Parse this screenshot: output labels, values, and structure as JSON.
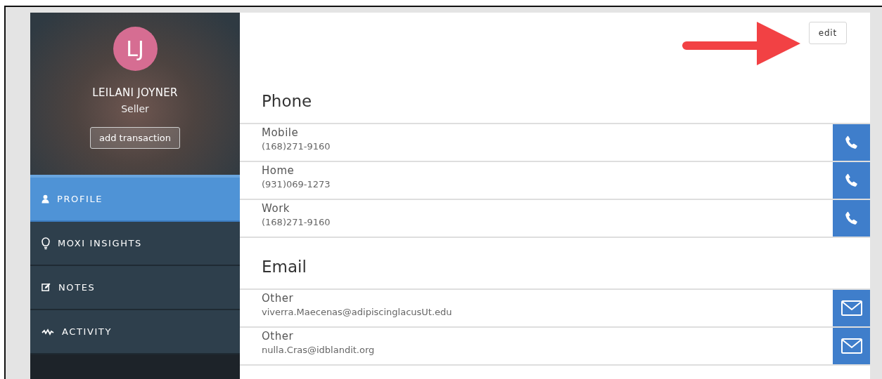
{
  "profile": {
    "initials": "LJ",
    "name": "LEILANI JOYNER",
    "role": "Seller",
    "action": "add transaction"
  },
  "nav": [
    {
      "label": "PROFILE",
      "kind": "user",
      "selected": true
    },
    {
      "label": "MOXI INSIGHTS",
      "kind": "bulb",
      "selected": false
    },
    {
      "label": "NOTES",
      "kind": "note",
      "selected": false
    },
    {
      "label": "ACTIVITY",
      "kind": "activity",
      "selected": false
    }
  ],
  "edit_button": "edit",
  "sections": [
    {
      "title": "Phone",
      "kind": "phone",
      "rows": [
        {
          "label": "Mobile",
          "value": "(168)271-9160"
        },
        {
          "label": "Home",
          "value": "(931)069-1273"
        },
        {
          "label": "Work",
          "value": "(168)271-9160"
        }
      ]
    },
    {
      "title": "Email",
      "kind": "email",
      "rows": [
        {
          "label": "Other",
          "value": "viverra.Maecenas@adipiscinglacusUt.edu"
        },
        {
          "label": "Other",
          "value": "nulla.Cras@idblandit.org"
        }
      ]
    }
  ]
}
